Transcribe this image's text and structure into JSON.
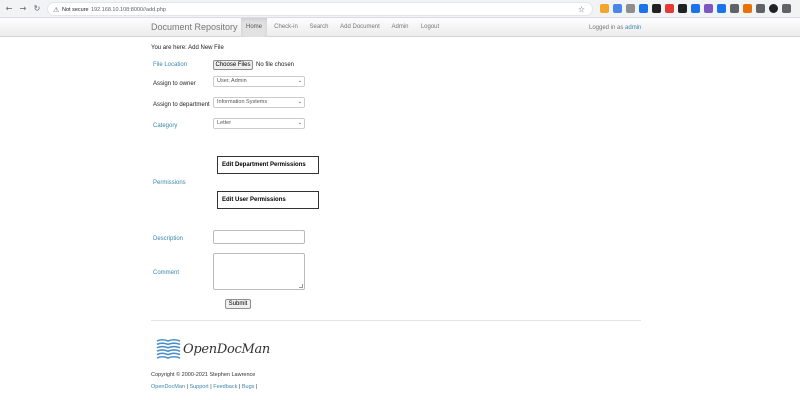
{
  "browser": {
    "security_label": "Not secure",
    "url": "192.168.10.108:8000//add.php",
    "back_glyph": "←",
    "forward_glyph": "→",
    "reload_glyph": "↻",
    "star_glyph": "☆",
    "security_glyph": "⚠",
    "extension_colors": [
      "#f4a62a",
      "#4a86e8",
      "#8e8e8e",
      "#1a73e8",
      "#202124",
      "#e53935",
      "#202124",
      "#1a73e8",
      "#7e57c2",
      "#1a73e8",
      "#5f6368",
      "#e8710a",
      "#5f6368",
      "#202124",
      "#5f6368"
    ]
  },
  "navbar": {
    "brand": "Document Repository",
    "links": [
      {
        "label": "Home",
        "active": true
      },
      {
        "label": "Check-in",
        "active": false
      },
      {
        "label": "Search",
        "active": false
      },
      {
        "label": "Add Document",
        "active": false
      },
      {
        "label": "Admin",
        "active": false
      },
      {
        "label": "Logout",
        "active": false
      }
    ],
    "logged_in_prefix": "Logged in as",
    "logged_in_user": "admin"
  },
  "breadcrumb": "You are here: Add New File",
  "form": {
    "file_location": {
      "label": "File Location",
      "button": "Choose Files",
      "status": "No file chosen"
    },
    "assign_owner": {
      "label": "Assign to owner",
      "value": "User, Admin"
    },
    "assign_department": {
      "label": "Assign to department",
      "value": "Information Systems"
    },
    "category": {
      "label": "Category",
      "value": "Letter"
    },
    "permissions": {
      "label": "Permissions",
      "edit_department": "Edit Department Permissions",
      "edit_user": "Edit User Permissions"
    },
    "description": {
      "label": "Description",
      "value": ""
    },
    "comment": {
      "label": "Comment",
      "value": ""
    },
    "submit": "Submit",
    "chevron_glyph": "⌄"
  },
  "footer": {
    "logo_text": "OpenDocMan",
    "copyright": "Copyright © 2000-2021 Stephen Lawrence",
    "links": [
      "OpenDocMan",
      "Support",
      "Feedback",
      "Bugs"
    ]
  },
  "colors": {
    "link_blue": "#3a87ad",
    "logo_blue": "#4a8fc7"
  }
}
